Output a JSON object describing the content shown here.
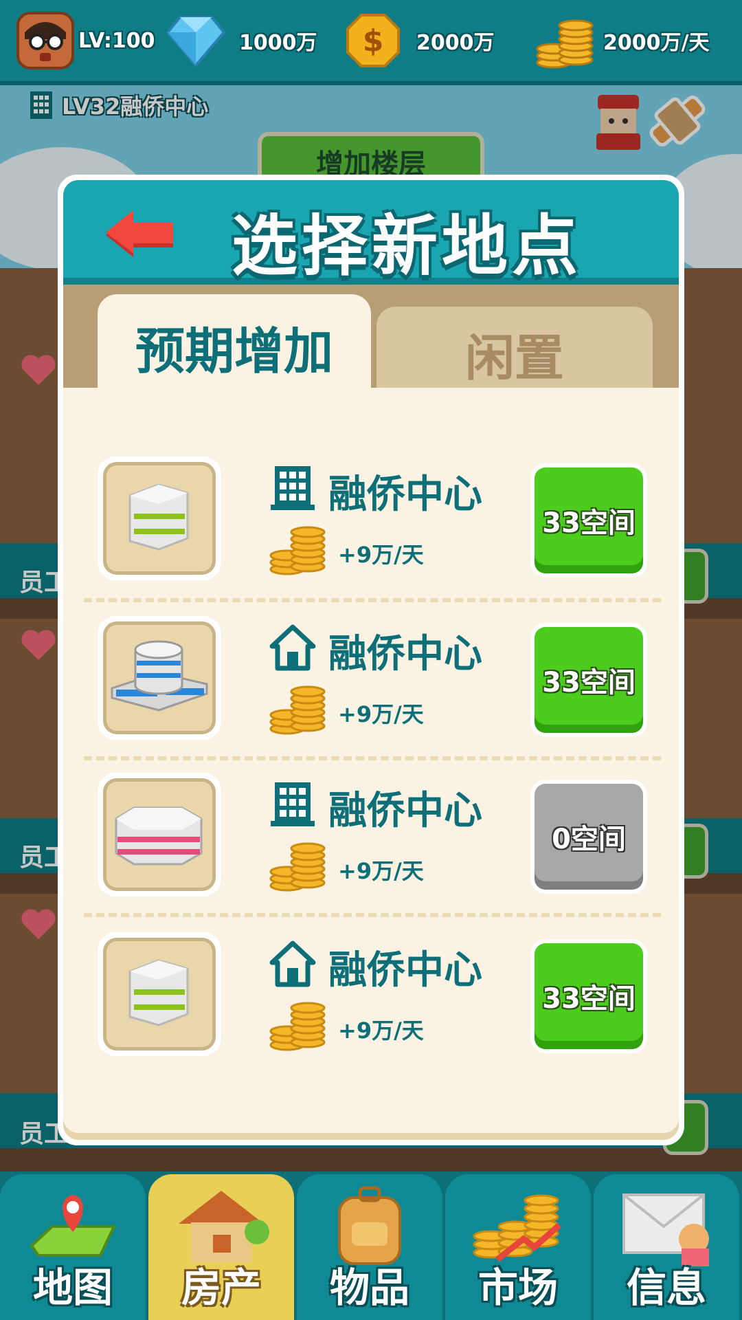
{
  "status_bar": {
    "level": "LV:100",
    "diamonds": "1000万",
    "cash": "2000万",
    "income": "2000万/天"
  },
  "building": {
    "title": "LV32融侨中心",
    "add_floor_label": "增加楼层"
  },
  "floors": [
    {
      "label": "员工"
    },
    {
      "label": "员工"
    },
    {
      "label": "员工"
    }
  ],
  "modal": {
    "title": "选择新地点",
    "tabs": [
      {
        "label": "预期增加",
        "selected": true
      },
      {
        "label": "闲置",
        "selected": false
      }
    ],
    "items": [
      {
        "type_icon": "office-building-icon",
        "name": "融侨中心",
        "income": "+9万/天",
        "space": "33空间",
        "available": true
      },
      {
        "type_icon": "house-icon",
        "name": "融侨中心",
        "income": "+9万/天",
        "space": "33空间",
        "available": true
      },
      {
        "type_icon": "office-building-icon",
        "name": "融侨中心",
        "income": "+9万/天",
        "space": "0空间",
        "available": false
      },
      {
        "type_icon": "house-icon",
        "name": "融侨中心",
        "income": "+9万/天",
        "space": "33空间",
        "available": true
      }
    ]
  },
  "bottom_nav": [
    {
      "label": "地图",
      "icon": "map-icon",
      "active": false
    },
    {
      "label": "房产",
      "icon": "property-icon",
      "active": true
    },
    {
      "label": "物品",
      "icon": "backpack-icon",
      "active": false
    },
    {
      "label": "市场",
      "icon": "market-icon",
      "active": false
    },
    {
      "label": "信息",
      "icon": "mail-icon",
      "active": false
    }
  ],
  "colors": {
    "teal": "#0e7d86",
    "header_teal": "#1aa6b0",
    "panel_cream": "#faf2e2",
    "button_green": "#4ccc1c",
    "button_gray": "#a8a8a8",
    "text_teal": "#0e6f78",
    "back_arrow_red": "#f0483c"
  }
}
